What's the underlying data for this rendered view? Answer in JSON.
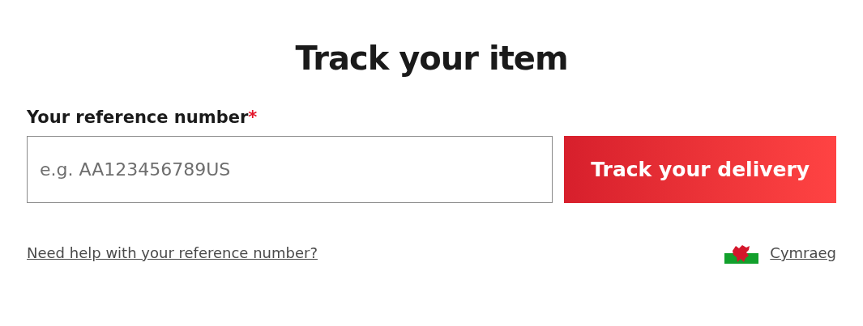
{
  "title": "Track your item",
  "field": {
    "label": "Your reference number",
    "required_mark": "*",
    "placeholder": "e.g. AA123456789US"
  },
  "button": "Track your delivery",
  "help_link": "Need help with your reference number?",
  "language_link": "Cymraeg"
}
